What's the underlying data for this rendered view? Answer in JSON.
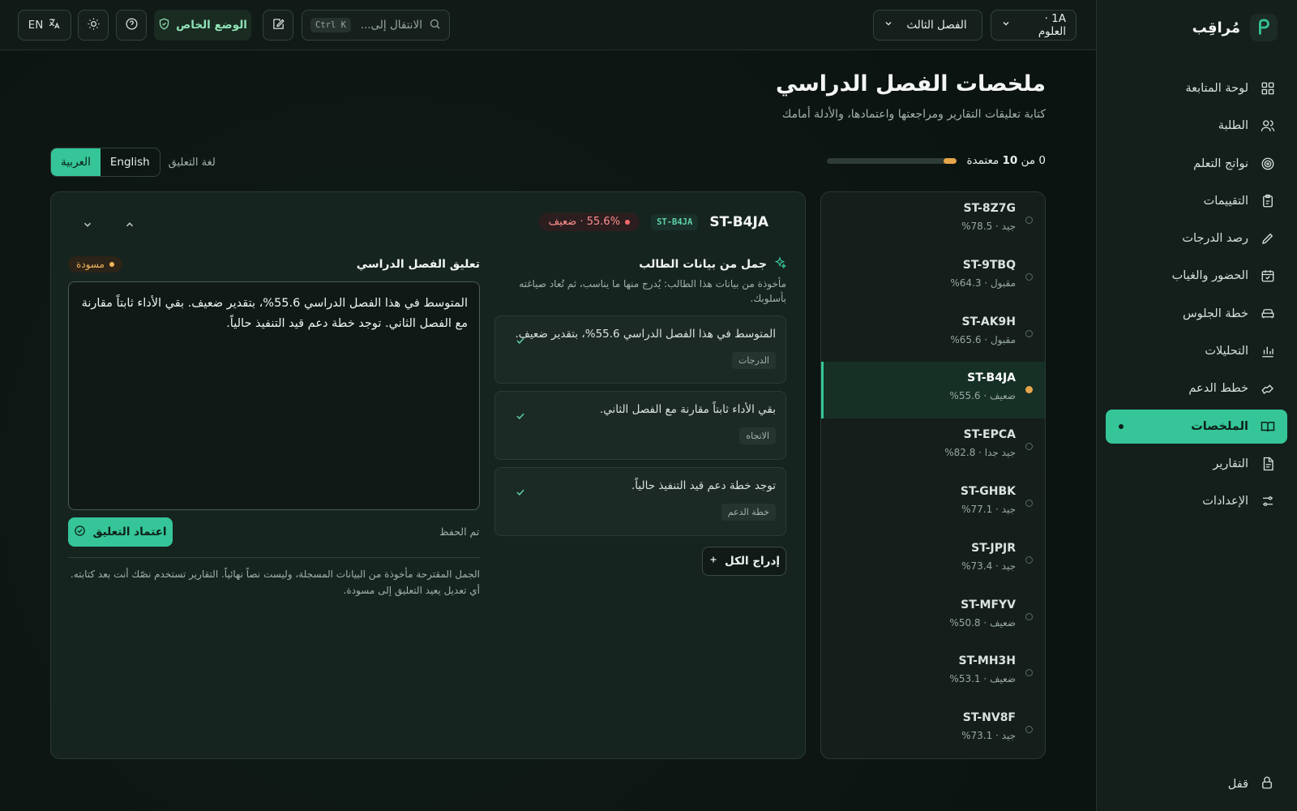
{
  "brand": {
    "name": "مُراقِب"
  },
  "sidebar": {
    "items": [
      {
        "label": "لوحة المتابعة",
        "icon": "dashboard-icon"
      },
      {
        "label": "الطلبة",
        "icon": "users-icon"
      },
      {
        "label": "نواتج التعلم",
        "icon": "target-icon"
      },
      {
        "label": "التقييمات",
        "icon": "clipboard-icon"
      },
      {
        "label": "رصد الدرجات",
        "icon": "pencil-icon"
      },
      {
        "label": "الحضور والغياب",
        "icon": "calendar-icon"
      },
      {
        "label": "خطة الجلوس",
        "icon": "sofa-icon"
      },
      {
        "label": "التحليلات",
        "icon": "bar-chart-icon"
      },
      {
        "label": "خطط الدعم",
        "icon": "helping-hand-icon"
      },
      {
        "label": "الملخصات",
        "icon": "book-open-icon",
        "active": true
      },
      {
        "label": "التقارير",
        "icon": "file-text-icon"
      },
      {
        "label": "الإعدادات",
        "icon": "sliders-icon"
      }
    ],
    "lock_label": "قفل"
  },
  "topbar": {
    "class_select": "1A · العلوم",
    "term_select": "الفصل الثالث",
    "search_placeholder": "الانتقال إلى...",
    "search_kbd": "Ctrl K",
    "private_mode": "الوضع الخاص",
    "lang_btn": "EN"
  },
  "page": {
    "title": "ملخصات الفصل الدراسي",
    "subtitle": "كتابة تعليقات التقارير ومراجعتها واعتمادها، والأدلة أمامك",
    "approved_prefix": "0 من ",
    "approved_total": "10",
    "approved_suffix": " معتمدة",
    "approved_fraction": 0.0,
    "lang_label": "لغة التعليق",
    "lang_options": [
      "English",
      "العربية"
    ],
    "lang_selected": "العربية"
  },
  "students": [
    {
      "id": "ST-8Z7G",
      "meta": "جيد · 78.5%"
    },
    {
      "id": "ST-9TBQ",
      "meta": "مقبول · 64.3%"
    },
    {
      "id": "ST-AK9H",
      "meta": "مقبول · 65.6%"
    },
    {
      "id": "ST-B4JA",
      "meta": "ضعيف · 55.6%",
      "active": true
    },
    {
      "id": "ST-EPCA",
      "meta": "جيد جدا · 82.8%"
    },
    {
      "id": "ST-GHBK",
      "meta": "جيد · 77.1%"
    },
    {
      "id": "ST-JPJR",
      "meta": "جيد · 73.4%"
    },
    {
      "id": "ST-MFYV",
      "meta": "ضعيف · 50.8%"
    },
    {
      "id": "ST-MH3H",
      "meta": "ضعيف · 53.1%"
    },
    {
      "id": "ST-NV8F",
      "meta": "جيد · 73.1%"
    }
  ],
  "detail": {
    "student_id": "ST-B4JA",
    "chip": "ST-B4JA",
    "grade_badge": "55.6% · ضعيف",
    "suggest_title": "جمل من بيانات الطالب",
    "suggest_sub": "مأخوذة من بيانات هذا الطالب: يُدرج منها ما يناسب، ثم تُعاد صياغته بأسلوبك.",
    "suggestions": [
      {
        "text": "المتوسط في هذا الفصل الدراسي 55.6%، بتقدير ضعيف.",
        "tag": "الدرجات"
      },
      {
        "text": "بقي الأداء ثابتاً مقارنة مع الفصل الثاني.",
        "tag": "الاتجاه"
      },
      {
        "text": "توجد خطة دعم قيد التنفيذ حالياً.",
        "tag": "خطة الدعم"
      }
    ],
    "insert_all": "إدراج الكل",
    "comment_title": "تعليق الفصل الدراسي",
    "draft_badge": "مسودة",
    "comment_text": "المتوسط في هذا الفصل الدراسي 55.6%، بتقدير ضعيف. بقي الأداء ثابتاً مقارنة مع الفصل الثاني. توجد خطة دعم قيد التنفيذ حالياً.",
    "approve_btn": "اعتماد التعليق",
    "saved": "تم الحفظ",
    "note": "الجمل المقترحة مأخوذة من البيانات المسجلة، وليست نصاً نهائياً. التقارير تستخدم نصّك أنت بعد كتابته. أي تعديل يعيد التعليق إلى مسودة."
  },
  "colors": {
    "accent": "#35c598",
    "warning": "#e6a54a",
    "danger": "#ff6b6b",
    "bg": "#0f1714"
  }
}
